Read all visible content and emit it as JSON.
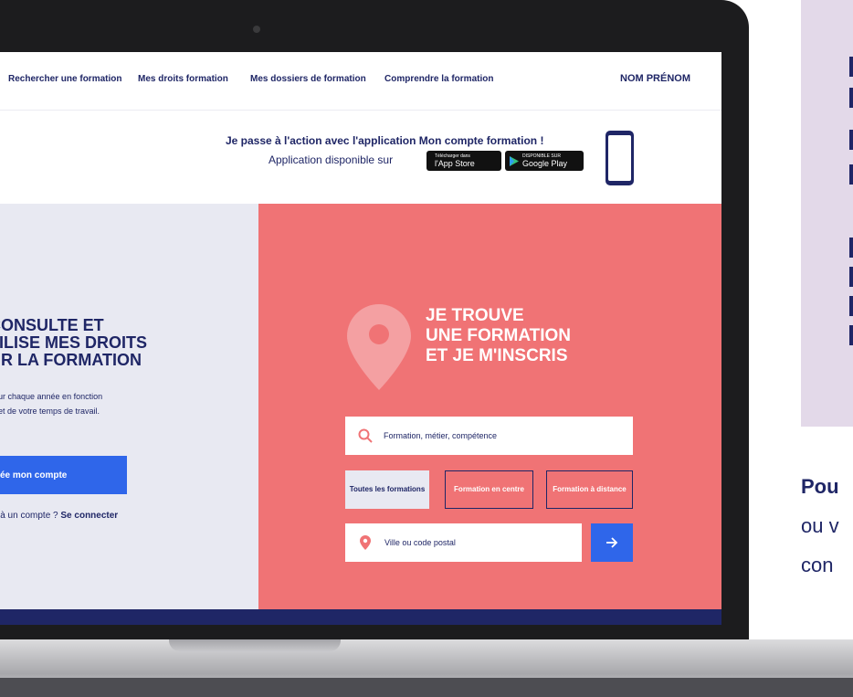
{
  "nav": {
    "items": [
      {
        "label": "Rechercher une formation"
      },
      {
        "label": "Mes droits formation"
      },
      {
        "label": "Mes dossiers de formation"
      },
      {
        "label": "Comprendre la formation"
      }
    ],
    "user": "NOM PRÉNOM"
  },
  "banner": {
    "title": "Je passe à l'action avec l'application Mon compte formation !",
    "subtitle": "Application disponible sur",
    "appstore_small": "Télécharger dans",
    "appstore_big": "l'App Store",
    "gplay_small": "DISPONIBLE SUR",
    "gplay_big": "Google Play"
  },
  "left": {
    "title_lines": [
      "CONSULTE ET",
      "TILISE MES DROITS",
      "UR LA FORMATION"
    ],
    "text_lines": [
      "ur chaque année en fonction",
      "et de votre temps de travail."
    ],
    "create_button": "ée mon compte",
    "login_prefix": "jà un compte ?",
    "login_link": "Se connecter"
  },
  "right": {
    "title_lines": [
      "JE TROUVE",
      "UNE FORMATION",
      "ET JE M'INSCRIS"
    ],
    "search_placeholder": "Formation, métier, compétence",
    "filters": {
      "all": "Toutes les formations",
      "centre": "Formation en centre",
      "distance": "Formation à distance"
    },
    "city_placeholder": "Ville ou code postal"
  },
  "side": {
    "line_bold": "Pou",
    "line2": "ou v",
    "line3": "con"
  },
  "colors": {
    "navy": "#1f2666",
    "coral": "#f07375",
    "lavender": "#e8e9f2",
    "blue": "#2f66ea",
    "side_panel": "#e3d9e9"
  }
}
